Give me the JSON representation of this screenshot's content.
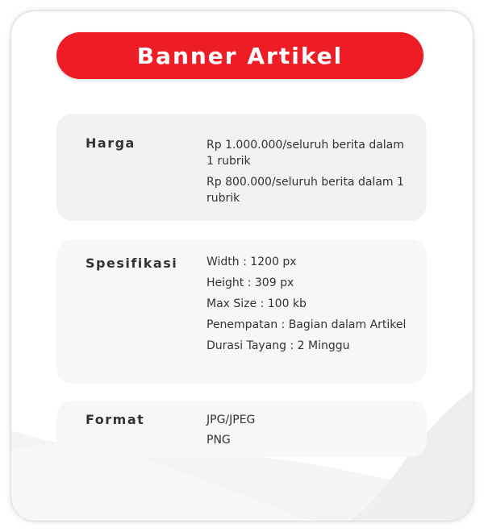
{
  "title": "Banner Artikel",
  "colors": {
    "accent": "#ee1d25",
    "section_bg": "#f2f2f2",
    "text": "#333333"
  },
  "sections": [
    {
      "label": "Harga",
      "values": [
        "Rp 1.000.000/seluruh berita dalam 1 rubrik",
        "Rp 800.000/seluruh berita dalam 1 rubrik"
      ]
    },
    {
      "label": "Spesifikasi",
      "values": [
        "Width : 1200 px",
        "Height : 309 px",
        "Max Size : 100 kb",
        "Penempatan : Bagian dalam Artikel",
        "Durasi Tayang : 2 Minggu"
      ]
    },
    {
      "label": "Format",
      "values": [
        "JPG/JPEG",
        "PNG"
      ]
    }
  ]
}
